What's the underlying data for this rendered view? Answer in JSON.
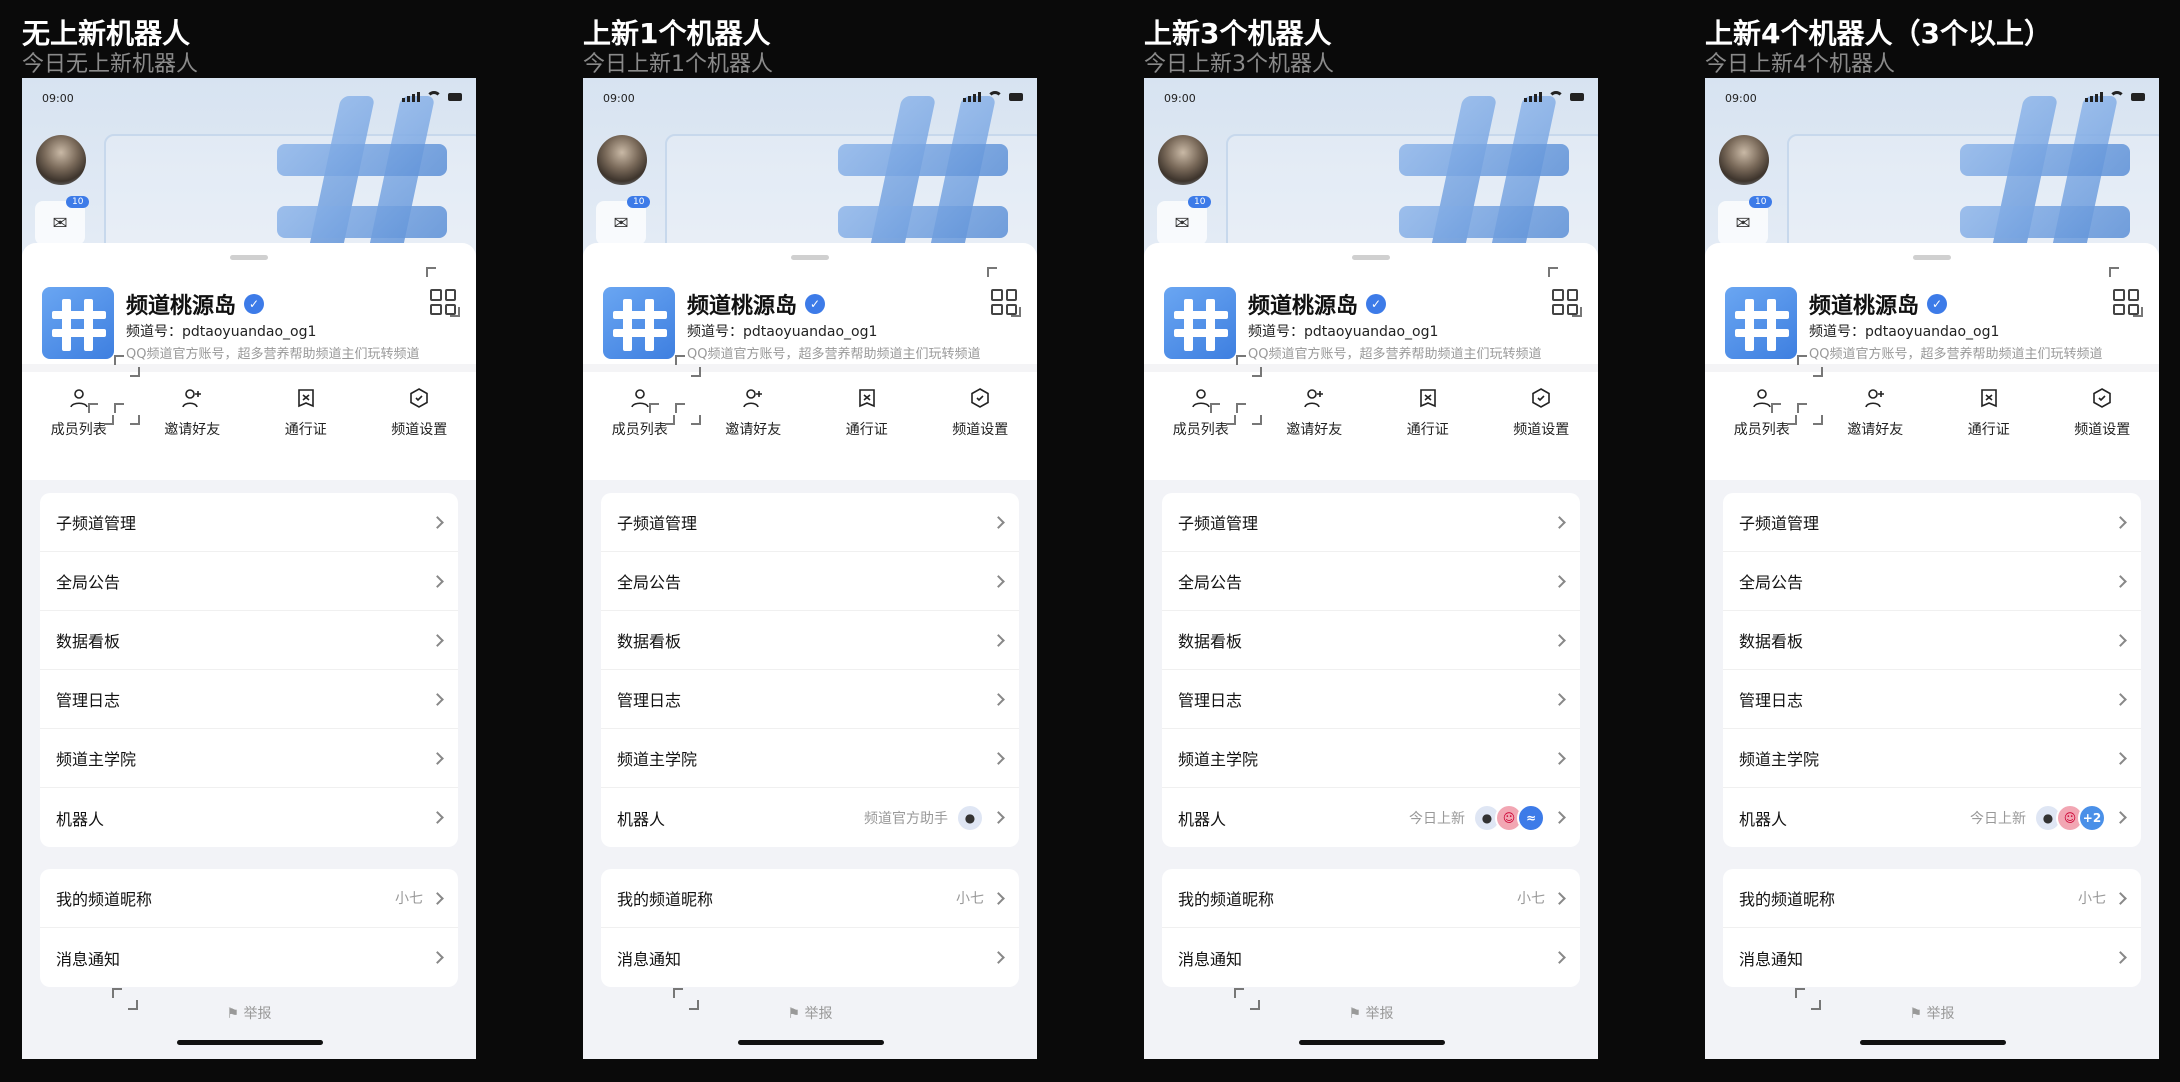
{
  "variants": [
    {
      "title": "无上新机器人",
      "subtitle": "今日无上新机器人",
      "bot_value": "",
      "bots": []
    },
    {
      "title": "上新1个机器人",
      "subtitle": "今日上新1个机器人",
      "bot_value": "频道官方助手",
      "bots": [
        "robot-avatar"
      ]
    },
    {
      "title": "上新3个机器人",
      "subtitle": "今日上新3个机器人",
      "bot_value": "今日上新",
      "bots": [
        "robot-avatar",
        "cute-avatar",
        "wave-avatar"
      ]
    },
    {
      "title": "上新4个机器人（3个以上）",
      "subtitle": "今日上新4个机器人",
      "bot_value": "今日上新",
      "bots": [
        "robot-avatar",
        "cute-avatar",
        "plus-badge"
      ],
      "plus_label": "+2"
    }
  ],
  "status": {
    "time": "09:00"
  },
  "mail_badge": "10",
  "channel": {
    "name": "频道桃源岛",
    "id_label": "频道号：pdtaoyuandao_og1",
    "desc": "QQ频道官方账号，超多营养帮助频道主们玩转频道"
  },
  "quick_actions": [
    {
      "label": "成员列表",
      "icon": "person-icon"
    },
    {
      "label": "邀请好友",
      "icon": "add-person-icon"
    },
    {
      "label": "通行证",
      "icon": "pass-icon"
    },
    {
      "label": "频道设置",
      "icon": "settings-icon"
    }
  ],
  "menu": {
    "items": [
      "子频道管理",
      "全局公告",
      "数据看板",
      "管理日志",
      "频道主学院",
      "机器人"
    ],
    "nickname_label": "我的频道昵称",
    "nickname_value": "小七",
    "notify_label": "消息通知"
  },
  "report": {
    "label": "举报"
  },
  "colors": {
    "accent": "#3d7be8",
    "background": "#0a0a0a",
    "sheet": "#f2f3f7"
  }
}
